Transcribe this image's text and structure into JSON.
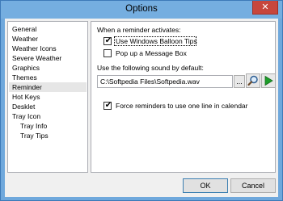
{
  "window": {
    "title": "Options",
    "close_label": "✕"
  },
  "nav": {
    "items": [
      {
        "label": "General"
      },
      {
        "label": "Weather"
      },
      {
        "label": "Weather Icons"
      },
      {
        "label": "Severe Weather"
      },
      {
        "label": "Graphics"
      },
      {
        "label": "Themes"
      },
      {
        "label": "Reminder",
        "selected": true
      },
      {
        "label": "Hot Keys"
      },
      {
        "label": "Desklet"
      },
      {
        "label": "Tray Icon"
      },
      {
        "label": "Tray Info",
        "indent": 1
      },
      {
        "label": "Tray Tips",
        "indent": 1
      }
    ]
  },
  "reminder": {
    "activates_label": "When a reminder activates:",
    "balloon_tips": {
      "label": "Use Windows Balloon Tips",
      "checked": true
    },
    "message_box": {
      "label": "Pop up a Message Box",
      "checked": false
    },
    "sound_label": "Use the following sound by default:",
    "sound_path": "C:\\Softpedia Files\\Softpedia.wav",
    "browse_label": "...",
    "one_line": {
      "label": "Force reminders to use one line in calendar",
      "checked": true
    },
    "check_mark": "✔"
  },
  "buttons": {
    "ok": "OK",
    "cancel": "Cancel"
  },
  "colors": {
    "play_green": "#1e9e2a",
    "accent_blue": "#3c7fb1"
  }
}
